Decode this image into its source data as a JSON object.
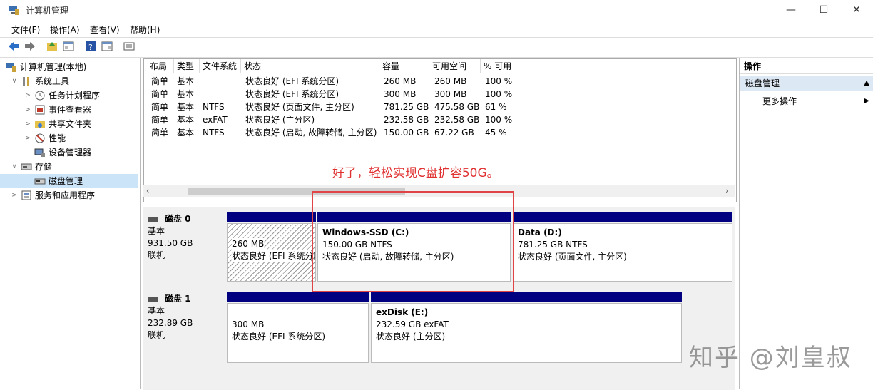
{
  "window": {
    "title": "计算机管理"
  },
  "menu": [
    "文件(F)",
    "操作(A)",
    "查看(V)",
    "帮助(H)"
  ],
  "tree": {
    "root": "计算机管理(本地)",
    "system_tools": "系统工具",
    "task_scheduler": "任务计划程序",
    "event_viewer": "事件查看器",
    "shared_folders": "共享文件夹",
    "performance": "性能",
    "device_manager": "设备管理器",
    "storage": "存储",
    "disk_management": "磁盘管理",
    "services": "服务和应用程序"
  },
  "volume_table": {
    "headers": [
      "布局",
      "类型",
      "文件系统",
      "状态",
      "容量",
      "可用空间",
      "% 可用"
    ],
    "rows": [
      [
        "简单",
        "基本",
        "",
        "状态良好 (EFI 系统分区)",
        "260 MB",
        "260 MB",
        "100 %"
      ],
      [
        "简单",
        "基本",
        "",
        "状态良好 (EFI 系统分区)",
        "300 MB",
        "300 MB",
        "100 %"
      ],
      [
        "简单",
        "基本",
        "NTFS",
        "状态良好 (页面文件, 主分区)",
        "781.25 GB",
        "475.58 GB",
        "61 %"
      ],
      [
        "简单",
        "基本",
        "exFAT",
        "状态良好 (主分区)",
        "232.58 GB",
        "232.58 GB",
        "100 %"
      ],
      [
        "简单",
        "基本",
        "NTFS",
        "状态良好 (启动, 故障转储, 主分区)",
        "150.00 GB",
        "67.22 GB",
        "45 %"
      ]
    ]
  },
  "disks": [
    {
      "name": "磁盘 0",
      "type": "基本",
      "size": "931.50 GB",
      "status": "联机",
      "partitions": [
        {
          "title": "",
          "size": "260 MB",
          "status": "状态良好 (EFI 系统分区)"
        },
        {
          "title": "Windows-SSD  (C:)",
          "size": "150.00 GB NTFS",
          "status": "状态良好 (启动, 故障转储, 主分区)"
        },
        {
          "title": "Data  (D:)",
          "size": "781.25 GB NTFS",
          "status": "状态良好 (页面文件, 主分区)"
        }
      ]
    },
    {
      "name": "磁盘 1",
      "type": "基本",
      "size": "232.89 GB",
      "status": "联机",
      "partitions": [
        {
          "title": "",
          "size": "300 MB",
          "status": "状态良好 (EFI 系统分区)"
        },
        {
          "title": "exDisk  (E:)",
          "size": "232.59 GB exFAT",
          "status": "状态良好 (主分区)"
        }
      ]
    }
  ],
  "actions": {
    "header": "操作",
    "section": "磁盘管理",
    "more": "更多操作"
  },
  "annotation": "好了，轻松实现C盘扩容50G。",
  "watermark": "知乎 @刘皇叔",
  "colors": {
    "partition_bar": "#000080",
    "annotation": "#e03030",
    "action_section_bg": "#dde8f5"
  }
}
